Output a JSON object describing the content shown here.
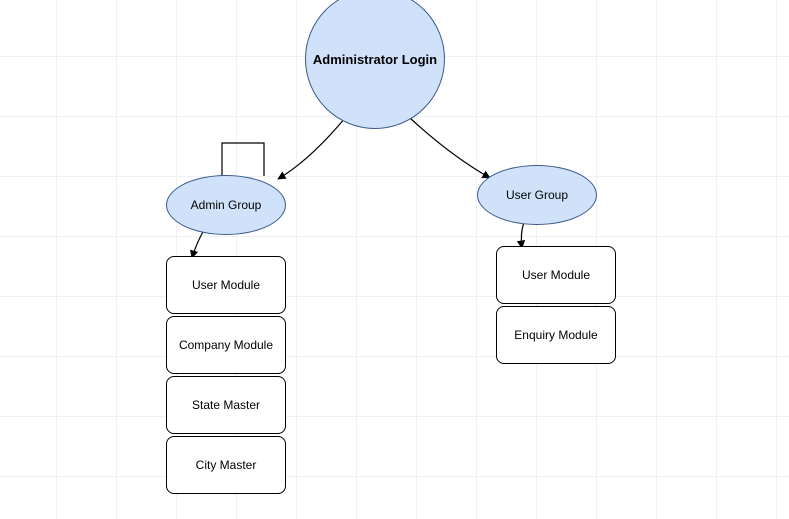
{
  "diagram": {
    "root": {
      "label": "Administrator Login"
    },
    "admin_group": {
      "label": "Admin Group"
    },
    "user_group": {
      "label": "User Group"
    },
    "admin_modules": [
      {
        "label": "User Module"
      },
      {
        "label": "Company Module"
      },
      {
        "label": "State Master"
      },
      {
        "label": "City Master"
      }
    ],
    "user_modules": [
      {
        "label": "User Module"
      },
      {
        "label": "Enquiry Module"
      }
    ]
  }
}
